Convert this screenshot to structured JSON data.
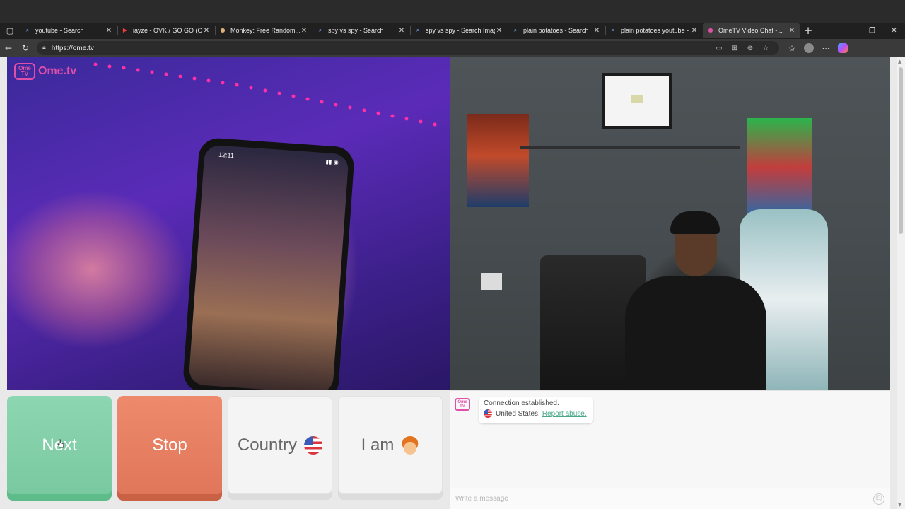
{
  "browser": {
    "tabs": [
      {
        "title": "youtube - Search",
        "icon": "search-favicon",
        "active": false
      },
      {
        "title": "iayze - OVK / GO GO (OFFI...",
        "icon": "youtube-favicon",
        "active": false
      },
      {
        "title": "Monkey: Free Random...",
        "icon": "monkey-favicon",
        "active": false
      },
      {
        "title": "spy vs spy - Search",
        "icon": "search-favicon",
        "active": false
      },
      {
        "title": "spy vs spy - Search Images",
        "icon": "search-favicon",
        "active": false
      },
      {
        "title": "plain potatoes - Search",
        "icon": "search-favicon",
        "active": false
      },
      {
        "title": "plain potatoes youtube - Se...",
        "icon": "search-favicon",
        "active": false
      },
      {
        "title": "OmeTV Video Chat -...",
        "icon": "ometv-favicon",
        "active": true
      }
    ],
    "url": "https://ome.tv"
  },
  "site": {
    "logo_badge": "Ome TV",
    "logo_word": "Ome.tv"
  },
  "controls": {
    "next_label": "Next",
    "stop_label": "Stop",
    "country_label": "Country",
    "iam_label": "I am"
  },
  "chat": {
    "logo_badge": "Ome TV",
    "status_message": "Connection established.",
    "country": "United States.",
    "report_link": "Report abuse.",
    "input_placeholder": "Write a message"
  },
  "colors": {
    "next": "#79c9a0",
    "stop": "#e0765a",
    "brand": "#e14fa8",
    "link": "#4aa88a"
  }
}
